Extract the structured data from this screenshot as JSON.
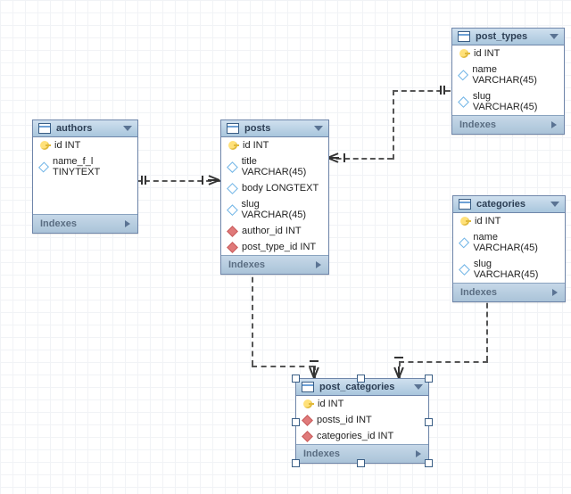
{
  "entities": {
    "authors": {
      "title": "authors",
      "columns": [
        {
          "icon": "key",
          "label": "id INT"
        },
        {
          "icon": "dia",
          "label": "name_f_l TINYTEXT"
        }
      ],
      "indexes_label": "Indexes"
    },
    "posts": {
      "title": "posts",
      "columns": [
        {
          "icon": "key",
          "label": "id INT"
        },
        {
          "icon": "dia",
          "label": "title VARCHAR(45)"
        },
        {
          "icon": "dia",
          "label": "body LONGTEXT"
        },
        {
          "icon": "dia",
          "label": "slug VARCHAR(45)"
        },
        {
          "icon": "dia-filled",
          "label": "author_id INT"
        },
        {
          "icon": "dia-filled",
          "label": "post_type_id INT"
        }
      ],
      "indexes_label": "Indexes"
    },
    "post_types": {
      "title": "post_types",
      "columns": [
        {
          "icon": "key",
          "label": "id INT"
        },
        {
          "icon": "dia",
          "label": "name VARCHAR(45)"
        },
        {
          "icon": "dia",
          "label": "slug VARCHAR(45)"
        }
      ],
      "indexes_label": "Indexes"
    },
    "categories": {
      "title": "categories",
      "columns": [
        {
          "icon": "key",
          "label": "id INT"
        },
        {
          "icon": "dia",
          "label": "name VARCHAR(45)"
        },
        {
          "icon": "dia",
          "label": "slug VARCHAR(45)"
        }
      ],
      "indexes_label": "Indexes"
    },
    "post_categories": {
      "title": "post_categories",
      "columns": [
        {
          "icon": "key",
          "label": "id INT"
        },
        {
          "icon": "dia-filled",
          "label": "posts_id INT"
        },
        {
          "icon": "dia-filled",
          "label": "categories_id INT"
        }
      ],
      "indexes_label": "Indexes"
    }
  }
}
